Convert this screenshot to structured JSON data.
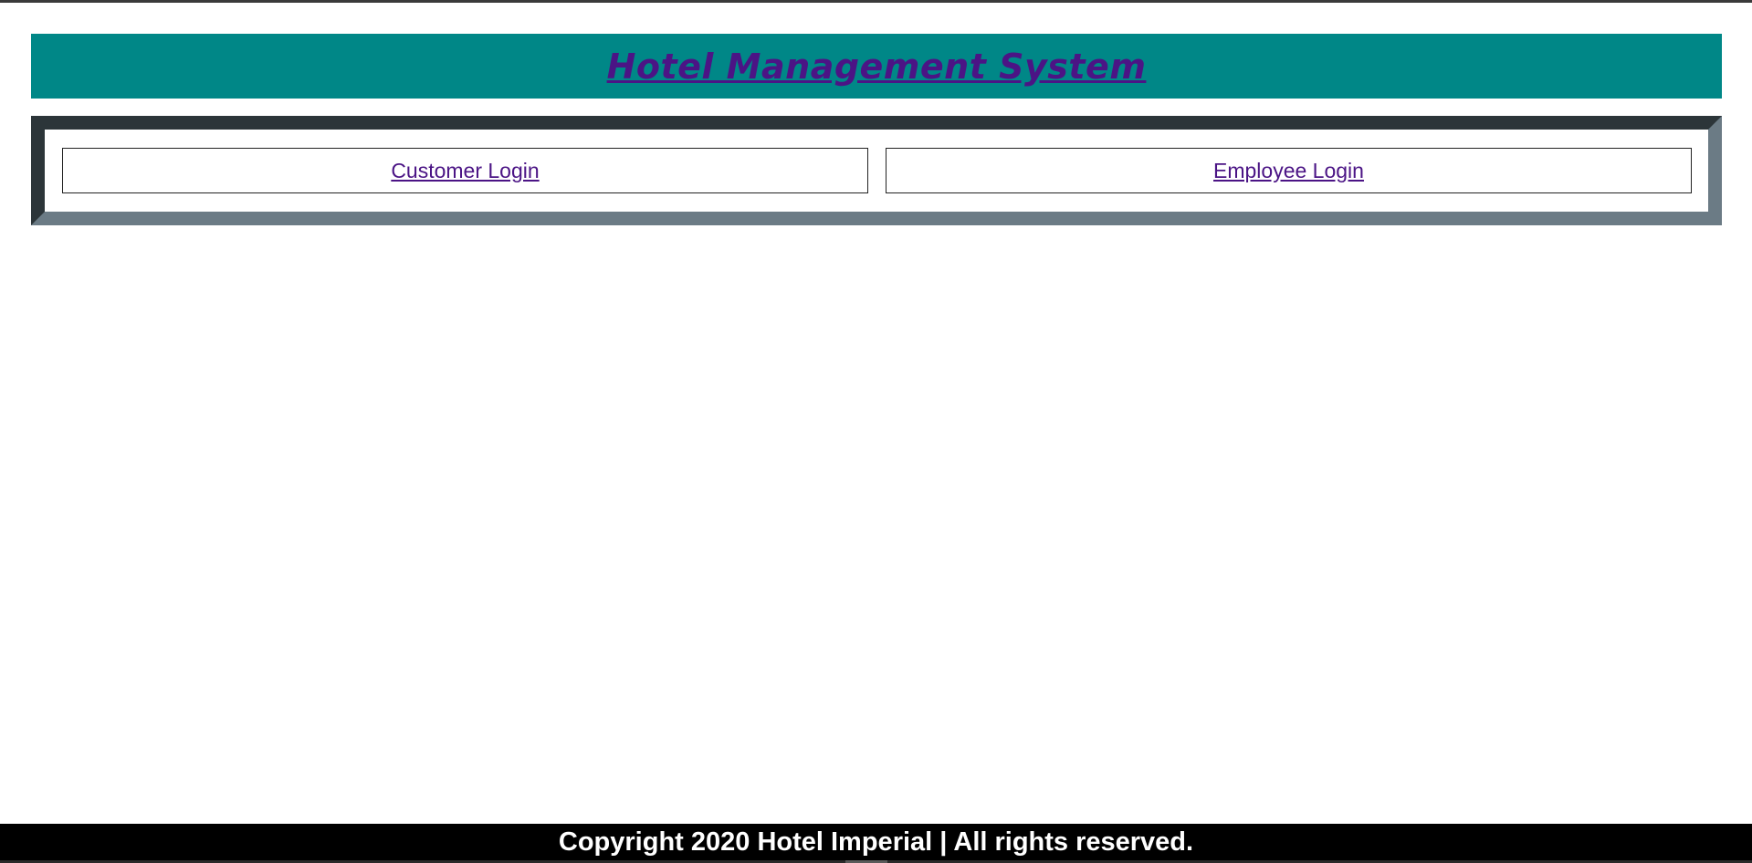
{
  "header": {
    "title": "Hotel Management System"
  },
  "login_options": {
    "customer_label": "Customer Login",
    "employee_label": "Employee Login"
  },
  "footer": {
    "text": "Copyright 2020 Hotel Imperial | All rights reserved."
  },
  "colors": {
    "header_bg": "#008787",
    "link": "#4b1485",
    "frame_dark": "#2c3539",
    "frame_light": "#6b7b85",
    "footer_bg": "#000000"
  }
}
